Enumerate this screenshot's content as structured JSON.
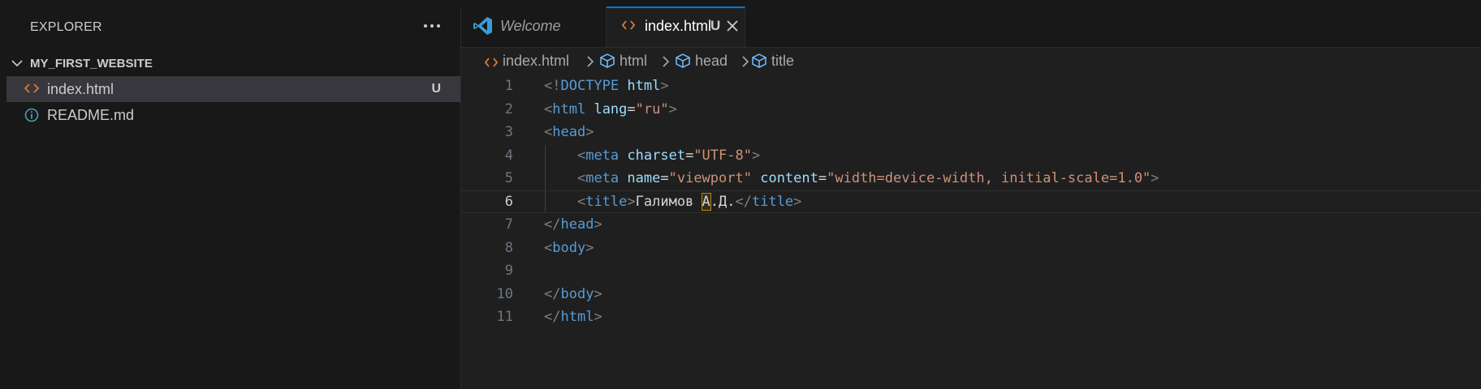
{
  "sidebar": {
    "title": "EXPLORER",
    "more_icon": "ellipsis-icon",
    "folder": {
      "name": "MY_FIRST_WEBSITE",
      "expanded": true
    },
    "files": [
      {
        "name": "index.html",
        "badge": "U",
        "icon": "html-file-icon",
        "selected": true
      },
      {
        "name": "README.md",
        "badge": "",
        "icon": "info-icon",
        "selected": false
      }
    ]
  },
  "tabs": [
    {
      "label": "Welcome",
      "icon": "vscode-icon",
      "active": false
    },
    {
      "label": "index.html",
      "badge": "U",
      "icon": "html-file-icon",
      "active": true
    }
  ],
  "breadcrumb": [
    "index.html",
    "html",
    "head",
    "title"
  ],
  "editor": {
    "current_line": 6,
    "lines": [
      {
        "n": "1",
        "tokens": [
          [
            "p",
            "<!"
          ],
          [
            "d",
            "DOCTYPE"
          ],
          [
            "x",
            " "
          ],
          [
            "a",
            "html"
          ],
          [
            "p",
            ">"
          ]
        ]
      },
      {
        "n": "2",
        "tokens": [
          [
            "p",
            "<"
          ],
          [
            "t",
            "html"
          ],
          [
            "x",
            " "
          ],
          [
            "a",
            "lang"
          ],
          [
            "x",
            "="
          ],
          [
            "s",
            "\"ru\""
          ],
          [
            "p",
            ">"
          ]
        ]
      },
      {
        "n": "3",
        "tokens": [
          [
            "p",
            "<"
          ],
          [
            "t",
            "head"
          ],
          [
            "p",
            ">"
          ]
        ]
      },
      {
        "n": "4",
        "tokens": [
          [
            "x",
            "    "
          ],
          [
            "p",
            "<"
          ],
          [
            "t",
            "meta"
          ],
          [
            "x",
            " "
          ],
          [
            "a",
            "charset"
          ],
          [
            "x",
            "="
          ],
          [
            "s",
            "\"UTF-8\""
          ],
          [
            "p",
            ">"
          ]
        ]
      },
      {
        "n": "5",
        "tokens": [
          [
            "x",
            "    "
          ],
          [
            "p",
            "<"
          ],
          [
            "t",
            "meta"
          ],
          [
            "x",
            " "
          ],
          [
            "a",
            "name"
          ],
          [
            "x",
            "="
          ],
          [
            "s",
            "\"viewport\""
          ],
          [
            "x",
            " "
          ],
          [
            "a",
            "content"
          ],
          [
            "x",
            "="
          ],
          [
            "s",
            "\"width=device-width, initial-scale=1.0\""
          ],
          [
            "p",
            ">"
          ]
        ]
      },
      {
        "n": "6",
        "tokens": [
          [
            "x",
            "    "
          ],
          [
            "p",
            "<"
          ],
          [
            "t",
            "title"
          ],
          [
            "p",
            ">"
          ],
          [
            "x",
            "Галимов "
          ],
          [
            "c",
            "А"
          ],
          [
            "x",
            ".Д."
          ],
          [
            "p",
            "</"
          ],
          [
            "t",
            "title"
          ],
          [
            "p",
            ">"
          ]
        ]
      },
      {
        "n": "7",
        "tokens": [
          [
            "p",
            "</"
          ],
          [
            "t",
            "head"
          ],
          [
            "p",
            ">"
          ]
        ]
      },
      {
        "n": "8",
        "tokens": [
          [
            "p",
            "<"
          ],
          [
            "t",
            "body"
          ],
          [
            "p",
            ">"
          ]
        ]
      },
      {
        "n": "9",
        "tokens": []
      },
      {
        "n": "10",
        "tokens": [
          [
            "p",
            "</"
          ],
          [
            "t",
            "body"
          ],
          [
            "p",
            ">"
          ]
        ]
      },
      {
        "n": "11",
        "tokens": [
          [
            "p",
            "</"
          ],
          [
            "t",
            "html"
          ],
          [
            "p",
            ">"
          ]
        ]
      }
    ]
  },
  "colors": {
    "accent": "#0078d4",
    "html_icon": "#e37933",
    "info_icon": "#519aba",
    "vscode_icon": "#3b9bd9"
  }
}
